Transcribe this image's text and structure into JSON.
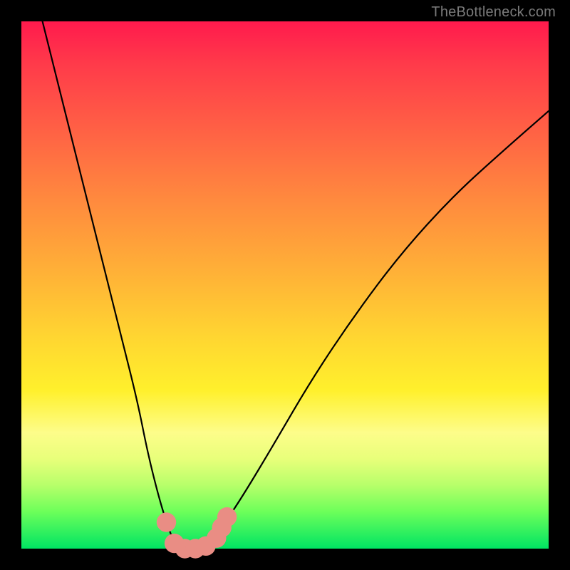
{
  "watermark": "TheBottleneck.com",
  "chart_data": {
    "type": "line",
    "title": "",
    "xlabel": "",
    "ylabel": "",
    "xlim": [
      0,
      100
    ],
    "ylim": [
      0,
      100
    ],
    "gradient_meaning": "background color encodes bottleneck severity: top=red (high), bottom=green (low)",
    "series": [
      {
        "name": "bottleneck-curve",
        "x": [
          4,
          7,
          10,
          13,
          16,
          19,
          22,
          24,
          26,
          27.5,
          29,
          31,
          33,
          36,
          38,
          42,
          48,
          55,
          63,
          72,
          82,
          92,
          100
        ],
        "y": [
          100,
          88,
          76,
          64,
          52,
          40,
          28,
          18,
          10,
          5,
          1,
          0,
          0,
          1,
          4,
          10,
          20,
          32,
          44,
          56,
          67,
          76,
          83
        ]
      }
    ],
    "markers": {
      "name": "highlighted-points",
      "color": "#e98d84",
      "points": [
        {
          "x": 27.5,
          "y": 5,
          "r": 1.3
        },
        {
          "x": 29,
          "y": 1,
          "r": 1.3
        },
        {
          "x": 31,
          "y": 0,
          "r": 1.3
        },
        {
          "x": 33,
          "y": 0,
          "r": 1.3
        },
        {
          "x": 35,
          "y": 0.5,
          "r": 1.3
        },
        {
          "x": 37,
          "y": 2,
          "r": 1.3
        },
        {
          "x": 38,
          "y": 4,
          "r": 1.3
        },
        {
          "x": 39,
          "y": 6,
          "r": 1.3
        }
      ]
    }
  }
}
